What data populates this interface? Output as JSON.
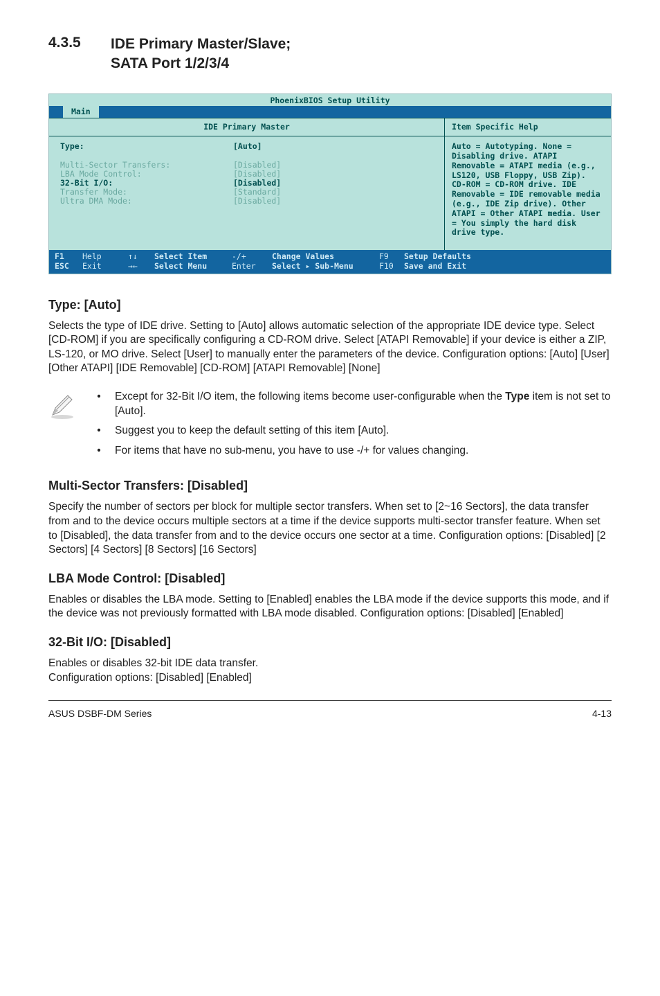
{
  "section": {
    "number": "4.3.5",
    "title_line1": "IDE Primary Master/Slave;",
    "title_line2": "SATA Port 1/2/3/4"
  },
  "bios": {
    "title": "PhoenixBIOS Setup Utility",
    "tab_main": "Main",
    "panel_title": "IDE Primary Master",
    "fields": {
      "type_label": "Type:",
      "type_value": "[Auto]",
      "multi_label": "Multi-Sector Transfers:",
      "multi_value": "[Disabled]",
      "lba_label": "LBA Mode Control:",
      "lba_value": "[Disabled]",
      "io_label": "32-Bit I/O:",
      "io_value": "[Disabled]",
      "xm_label": "Transfer Mode:",
      "xm_value": "[Standard]",
      "dma_label": "Ultra DMA Mode:",
      "dma_value": "[Disabled]"
    },
    "help_title": "Item Specific Help",
    "help_body": "Auto = Autotyping.\nNone = Disabling drive.\nATAPI Removable = ATAPI media (e.g., LS120, USB Floppy, USB Zip).\nCD-ROM = CD-ROM drive.\nIDE Removable = IDE removable media (e.g., IDE Zip drive).\nOther ATAPI = Other ATAPI media.\nUser = You simply the hard disk drive type.",
    "footer": {
      "f1": "F1",
      "help": "Help",
      "up_down": "↑↓",
      "select_item": "Select Item",
      "minus_plus": "-/+",
      "change_values": "Change Values",
      "f9": "F9",
      "setup_defaults": "Setup Defaults",
      "esc": "ESC",
      "exit": "Exit",
      "left_right": "→←",
      "select_menu": "Select Menu",
      "enter": "Enter",
      "select_submenu": "Select ▸ Sub-Menu",
      "f10": "F10",
      "save_exit": "Save and Exit"
    }
  },
  "sub_type": {
    "heading": "Type: [Auto]",
    "body": "Selects the type of IDE drive. Setting to [Auto] allows automatic selection of the appropriate IDE device type. Select [CD-ROM] if you are specifically configuring a CD-ROM drive. Select [ATAPI Removable] if your device is either a ZIP, LS-120, or MO drive. Select [User] to manually enter the parameters of the device. Configuration options: [Auto] [User] [Other ATAPI] [IDE Removable] [CD-ROM] [ATAPI Removable] [None]"
  },
  "notes": {
    "n1_pre": "Except for 32-Bit I/O item, the following items become user-configurable when the ",
    "n1_bold": "Type",
    "n1_post": " item is not set to [Auto].",
    "n2": "Suggest you to keep the default setting of this item [Auto].",
    "n3": "For items that have no sub-menu, you have to use -/+ for values changing."
  },
  "sub_multi": {
    "heading": "Multi-Sector Transfers: [Disabled]",
    "body": "Specify the number of sectors per block for multiple sector transfers. When set to [2~16 Sectors], the data transfer from and to the device occurs multiple sectors at a time if the device supports multi-sector transfer feature. When set to [Disabled], the data transfer from and to the device occurs one sector at a time. Configuration options: [Disabled] [2 Sectors] [4 Sectors] [8 Sectors] [16 Sectors]"
  },
  "sub_lba": {
    "heading": "LBA Mode Control: [Disabled]",
    "body": "Enables or disables the LBA mode. Setting to [Enabled] enables the LBA mode if the device supports this mode, and if the device was not previously formatted with LBA mode disabled. Configuration options: [Disabled] [Enabled]"
  },
  "sub_io": {
    "heading": "32-Bit I/O: [Disabled]",
    "body": "Enables or disables 32-bit IDE data transfer.\nConfiguration options: [Disabled] [Enabled]"
  },
  "footer": {
    "left": "ASUS DSBF-DM Series",
    "right": "4-13"
  }
}
